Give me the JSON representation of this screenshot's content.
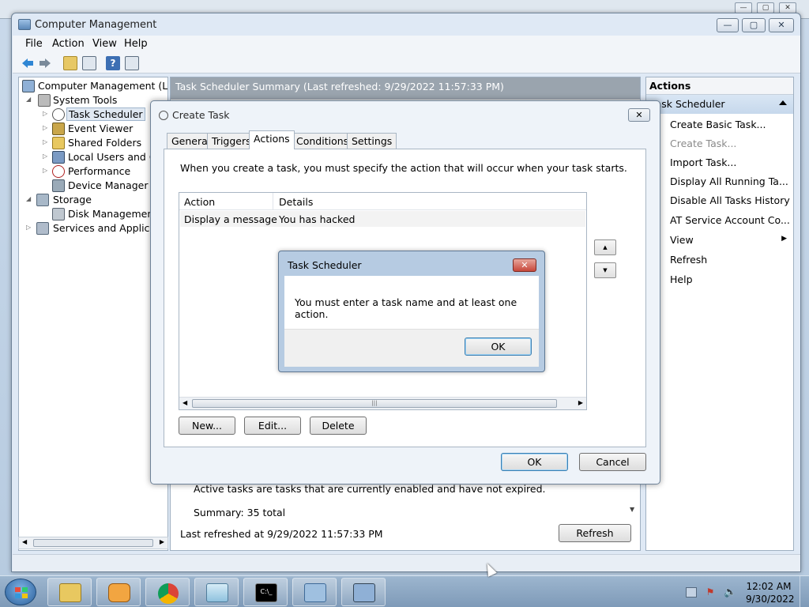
{
  "window": {
    "title": "Computer Management",
    "menu": [
      "File",
      "Action",
      "View",
      "Help"
    ]
  },
  "tree": [
    {
      "label": "Computer Management (Local",
      "icon": "computer-icon"
    },
    {
      "label": "System Tools",
      "icon": "tools-icon"
    },
    {
      "label": "Task Scheduler",
      "icon": "clock-icon",
      "selected": true
    },
    {
      "label": "Event Viewer",
      "icon": "event-viewer-icon"
    },
    {
      "label": "Shared Folders",
      "icon": "folder-icon"
    },
    {
      "label": "Local Users and Gro",
      "icon": "users-icon"
    },
    {
      "label": "Performance",
      "icon": "performance-icon"
    },
    {
      "label": "Device Manager",
      "icon": "device-manager-icon"
    },
    {
      "label": "Storage",
      "icon": "storage-icon"
    },
    {
      "label": "Disk Management",
      "icon": "disk-icon"
    },
    {
      "label": "Services and Application",
      "icon": "services-icon"
    }
  ],
  "center": {
    "header": "Task Scheduler Summary (Last refreshed: 9/29/2022 11:57:33 PM)",
    "active_tasks_desc": "Active tasks are tasks that are currently enabled and have not expired.",
    "summary": "Summary: 35 total",
    "last_refreshed": "Last refreshed at 9/29/2022 11:57:33 PM",
    "refresh_button": "Refresh"
  },
  "actions_pane": {
    "header": "Actions",
    "section": "Task Scheduler",
    "items": [
      {
        "label": "Create Basic Task...",
        "enabled": true
      },
      {
        "label": "Create Task...",
        "enabled": false
      },
      {
        "label": "Import Task...",
        "enabled": true
      },
      {
        "label": "Display All Running Ta...",
        "enabled": true
      },
      {
        "label": "Disable All Tasks History",
        "enabled": true
      },
      {
        "label": "AT Service Account Co...",
        "enabled": true
      },
      {
        "label": "View",
        "enabled": true,
        "submenu": true
      },
      {
        "label": "Refresh",
        "enabled": true
      },
      {
        "label": "Help",
        "enabled": true
      }
    ]
  },
  "create_task": {
    "title": "Create Task",
    "tabs": [
      "General",
      "Triggers",
      "Actions",
      "Conditions",
      "Settings"
    ],
    "active_tab": "Actions",
    "description": "When you create a task, you must specify the action that will occur when your task starts.",
    "columns": [
      "Action",
      "Details"
    ],
    "rows": [
      {
        "action": "Display a message",
        "details": "You has hacked"
      }
    ],
    "buttons": {
      "new": "New...",
      "edit": "Edit...",
      "delete": "Delete",
      "ok": "OK",
      "cancel": "Cancel"
    }
  },
  "message_box": {
    "title": "Task Scheduler",
    "message": "You must enter a task name and at least one action.",
    "ok": "OK"
  },
  "taskbar": {
    "clock_time": "12:02 AM",
    "clock_date": "9/30/2022"
  }
}
